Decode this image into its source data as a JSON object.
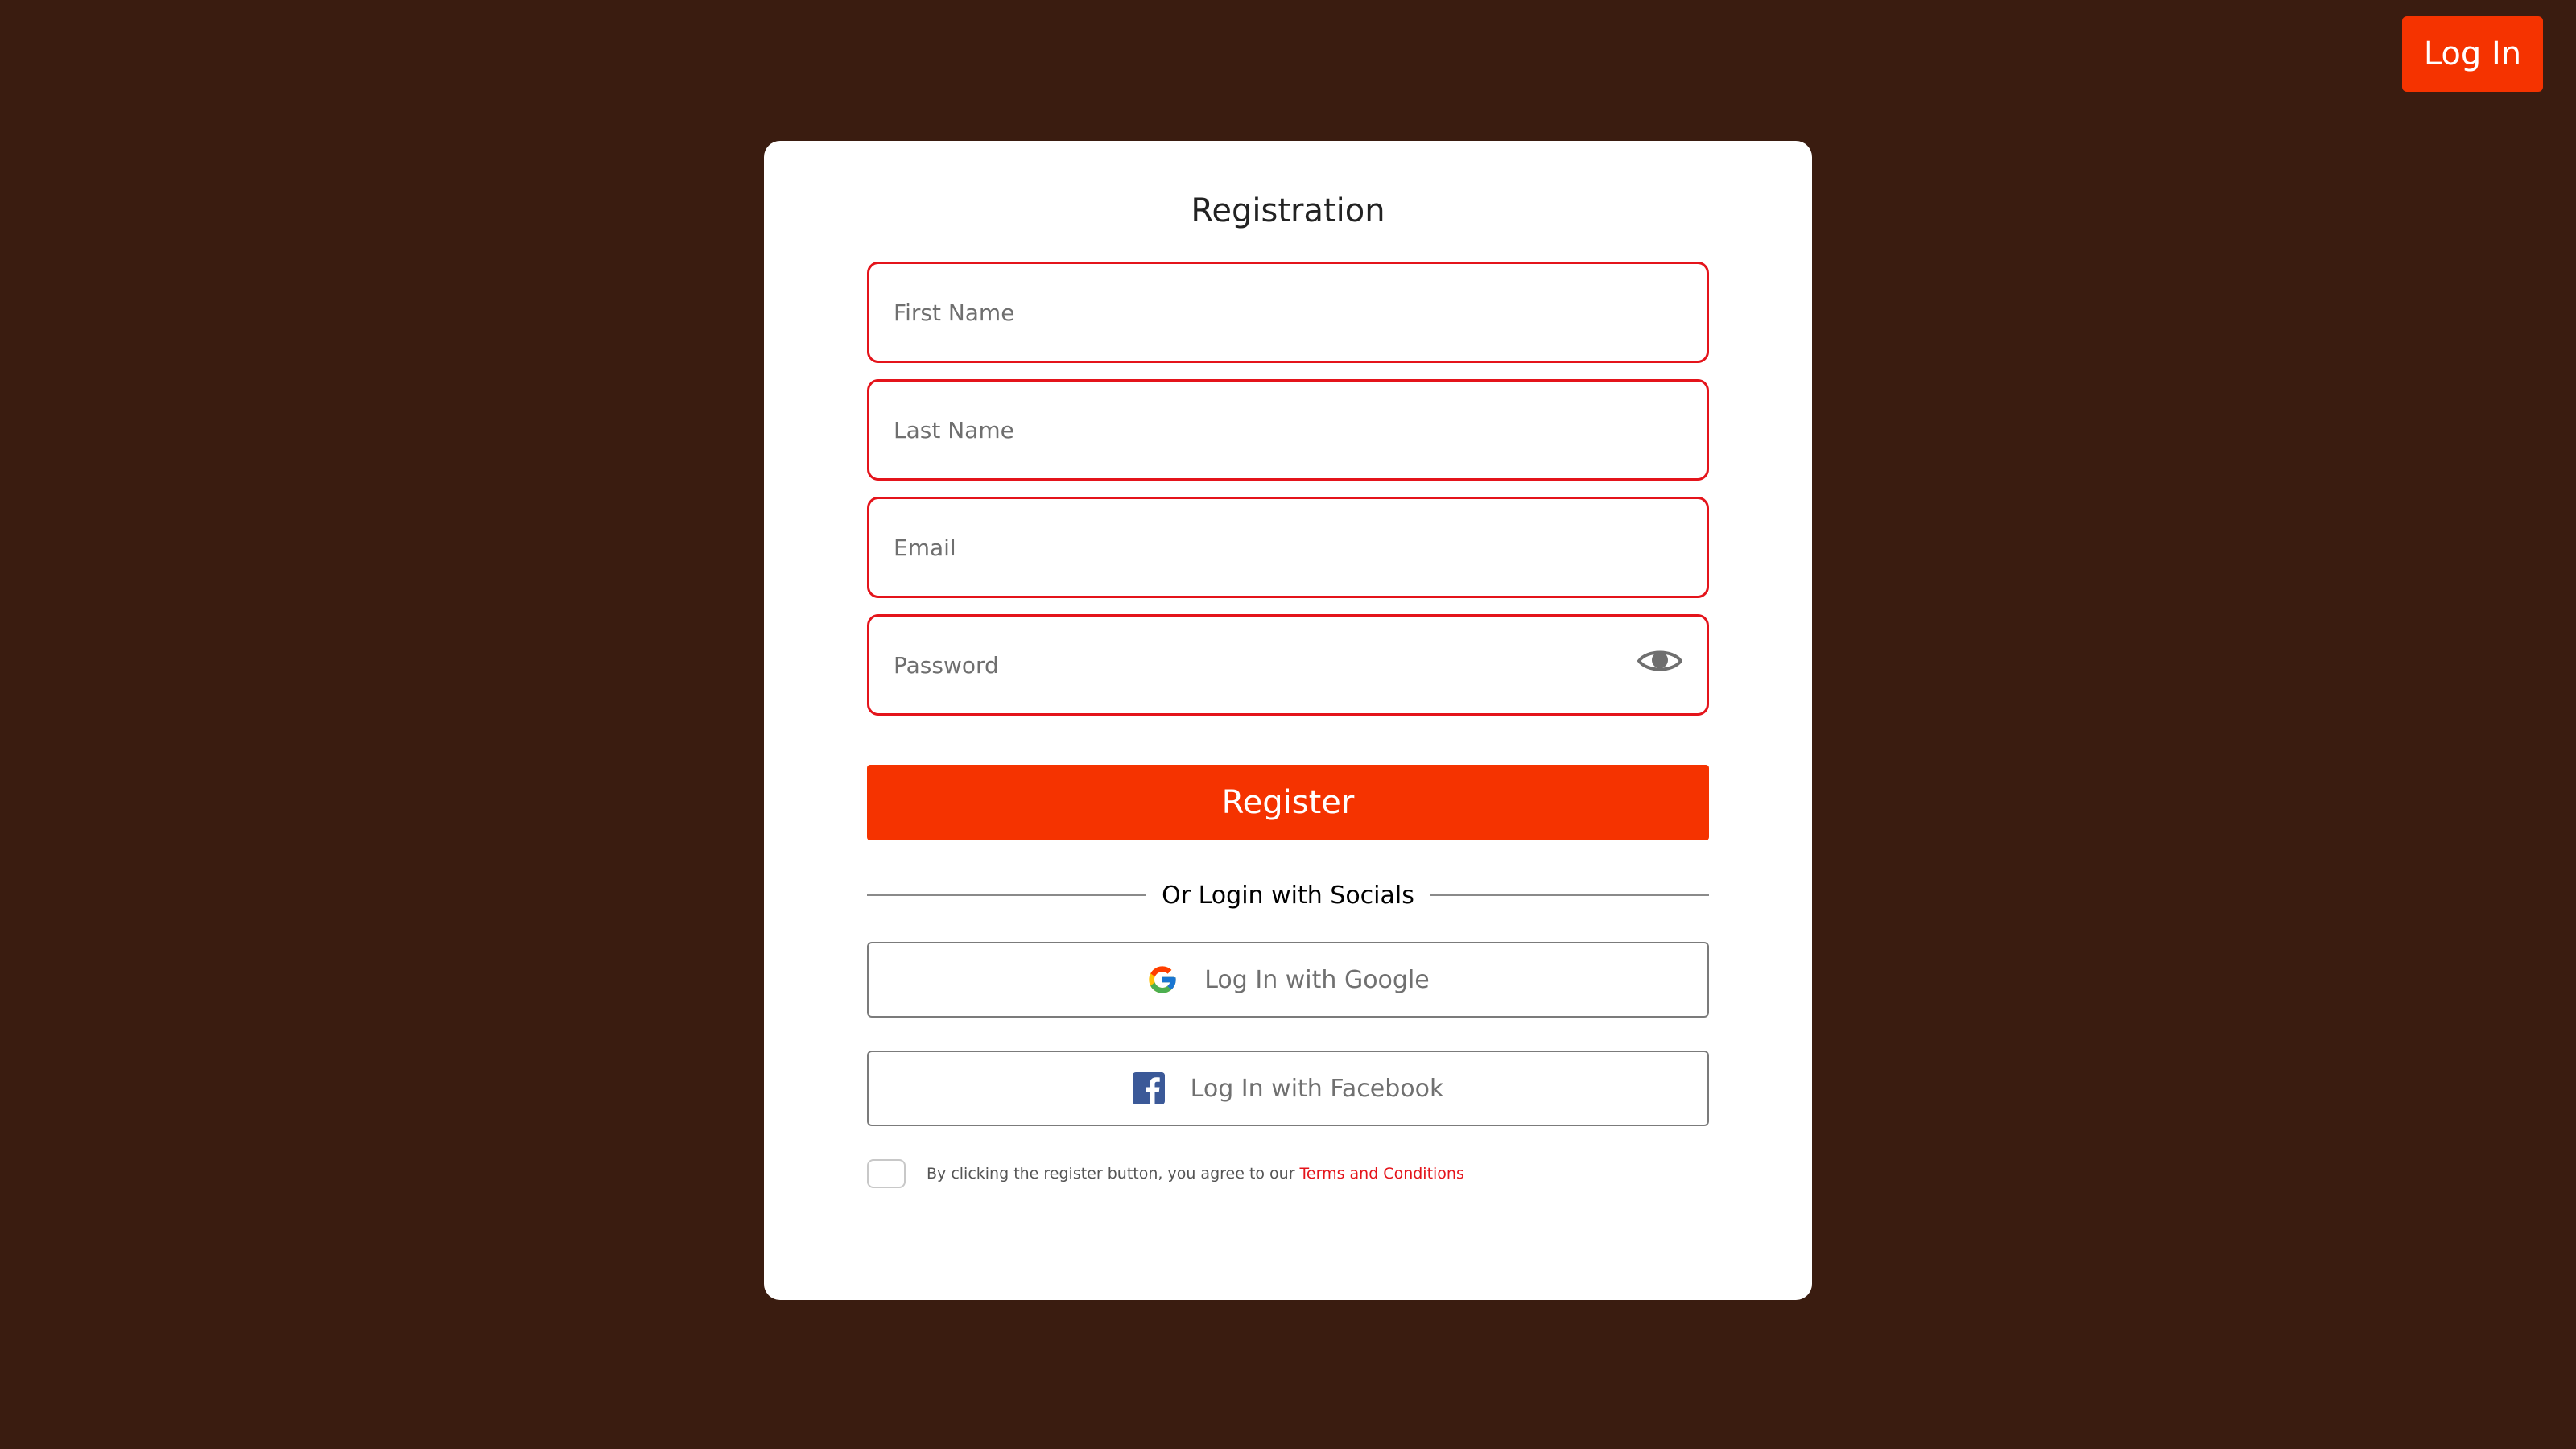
{
  "header": {
    "login_label": "Log In"
  },
  "form": {
    "title": "Registration",
    "first_name_placeholder": "First Name",
    "last_name_placeholder": "Last Name",
    "email_placeholder": "Email",
    "password_placeholder": "Password",
    "register_label": "Register",
    "divider_text": "Or Login with Socials",
    "google_label": "Log In with Google",
    "facebook_label": "Log In with Facebook",
    "terms_text": "By clicking the register button, you agree to our",
    "terms_link": "Terms and Conditions"
  },
  "icons": {
    "password_toggle": "eye-icon",
    "google": "google-icon",
    "facebook": "facebook-icon"
  },
  "colors": {
    "background": "#3a1c10",
    "accent": "#f53300",
    "input_border": "#e4141b",
    "card": "#ffffff",
    "facebook": "#3b5998"
  }
}
